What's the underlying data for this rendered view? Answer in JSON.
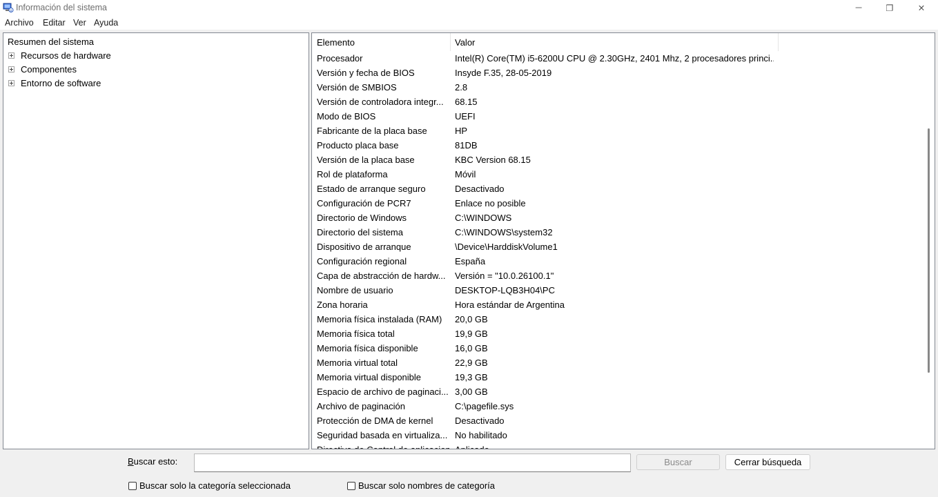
{
  "window": {
    "title": "Información del sistema",
    "controls": {
      "minimize": "─",
      "restore": "❐",
      "close": "✕"
    }
  },
  "menu": [
    "Archivo",
    "Editar",
    "Ver",
    "Ayuda"
  ],
  "tree": {
    "root": "Resumen del sistema",
    "children": [
      "Recursos de hardware",
      "Componentes",
      "Entorno de software"
    ]
  },
  "table": {
    "headers": [
      "Elemento",
      "Valor"
    ],
    "rows": [
      [
        "Procesador",
        "Intel(R) Core(TM) i5-6200U CPU @ 2.30GHz, 2401 Mhz, 2 procesadores princi..."
      ],
      [
        "Versión y fecha de BIOS",
        "Insyde F.35, 28-05-2019"
      ],
      [
        "Versión de SMBIOS",
        "2.8"
      ],
      [
        "Versión de controladora integr...",
        "68.15"
      ],
      [
        "Modo de BIOS",
        "UEFI"
      ],
      [
        "Fabricante de la placa base",
        "HP"
      ],
      [
        "Producto placa base",
        "81DB"
      ],
      [
        "Versión de la placa base",
        "KBC Version 68.15"
      ],
      [
        "Rol de plataforma",
        "Móvil"
      ],
      [
        "Estado de arranque seguro",
        "Desactivado"
      ],
      [
        "Configuración de PCR7",
        "Enlace no posible"
      ],
      [
        "Directorio de Windows",
        "C:\\WINDOWS"
      ],
      [
        "Directorio del sistema",
        "C:\\WINDOWS\\system32"
      ],
      [
        "Dispositivo de arranque",
        "\\Device\\HarddiskVolume1"
      ],
      [
        "Configuración regional",
        "España"
      ],
      [
        "Capa de abstracción de hardw...",
        "Versión = \"10.0.26100.1\""
      ],
      [
        "Nombre de usuario",
        "DESKTOP-LQB3H04\\PC"
      ],
      [
        "Zona horaria",
        "Hora estándar de Argentina"
      ],
      [
        "Memoria física instalada (RAM)",
        "20,0 GB"
      ],
      [
        "Memoria física total",
        "19,9 GB"
      ],
      [
        "Memoria física disponible",
        "16,0 GB"
      ],
      [
        "Memoria virtual total",
        "22,9 GB"
      ],
      [
        "Memoria virtual disponible",
        "19,3 GB"
      ],
      [
        "Espacio de archivo de paginaci...",
        "3,00 GB"
      ],
      [
        "Archivo de paginación",
        "C:\\pagefile.sys"
      ],
      [
        "Protección de DMA de kernel",
        "Desactivado"
      ],
      [
        "Seguridad basada en virtualiza...",
        "No habilitado"
      ],
      [
        "Directiva de Control de aplicaciones...",
        "Aplicado"
      ]
    ]
  },
  "search": {
    "label": "Buscar esto:",
    "value": "",
    "buscar_button": "Buscar",
    "cerrar_button": "Cerrar búsqueda",
    "chk_categoria": "Buscar solo la categoría seleccionada",
    "chk_nombres": "Buscar solo nombres de categoría"
  }
}
